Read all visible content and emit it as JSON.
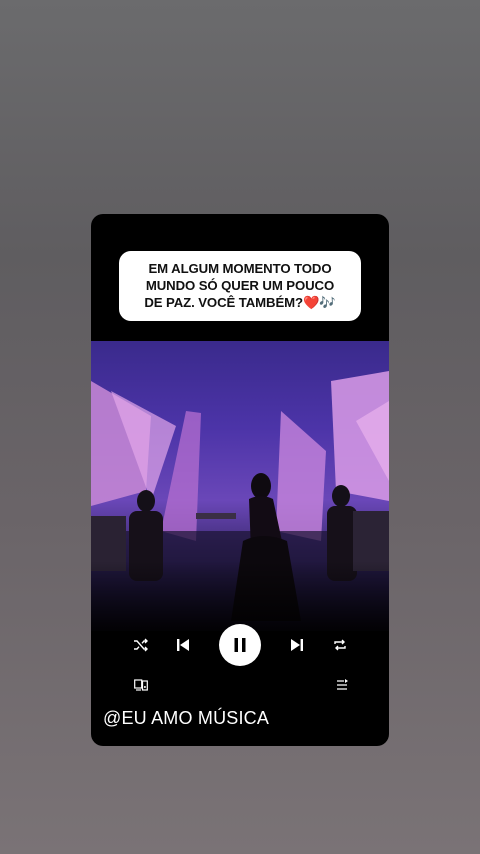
{
  "caption": {
    "line1": "EM ALGUM MOMENTO TODO",
    "line2": "MUNDO SÓ QUER UM POUCO",
    "line3": "DE PAZ. VOCÊ TAMBÉM?",
    "emoji_heart": "❤️",
    "emoji_notes": "🎶"
  },
  "player": {
    "shuffle_icon": "shuffle-icon",
    "previous_icon": "skip-previous-icon",
    "pause_icon": "pause-icon",
    "next_icon": "skip-next-icon",
    "repeat_icon": "repeat-icon",
    "devices_icon": "devices-icon",
    "queue_icon": "queue-icon"
  },
  "handle": "@EU AMO MÚSICA",
  "colors": {
    "card_bg": "#000000",
    "caption_bg": "#ffffff",
    "video_primary": "#4c34a8",
    "video_accent": "#d98be0"
  }
}
